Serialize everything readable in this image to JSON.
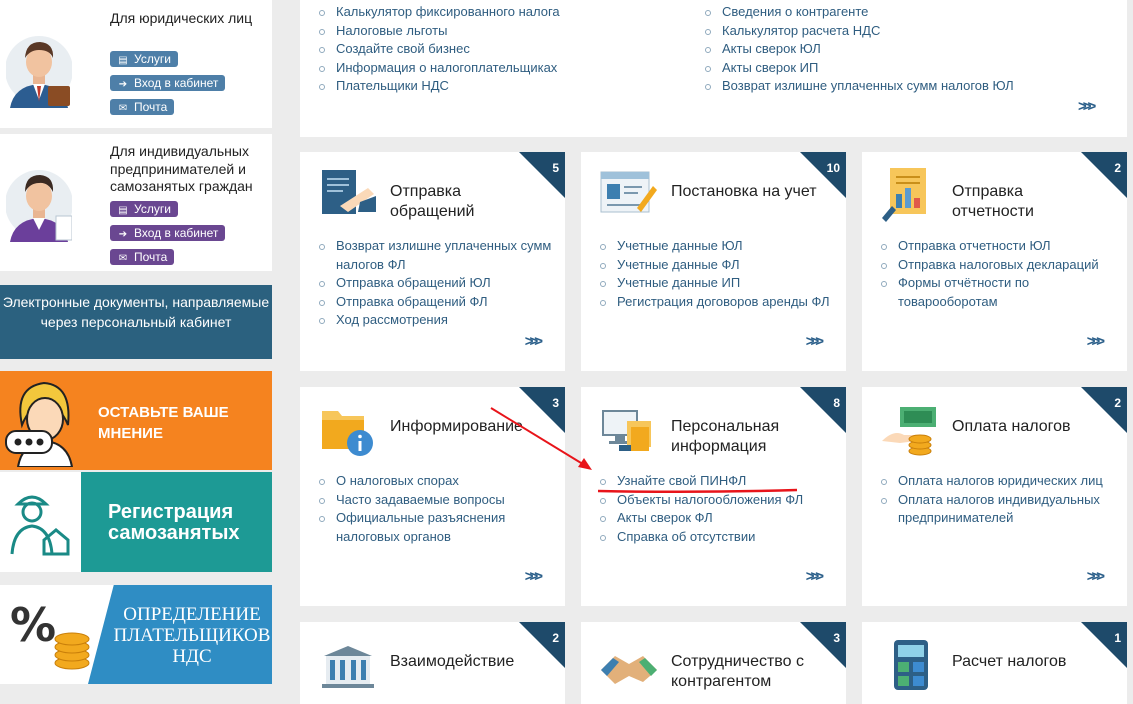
{
  "sidebar": {
    "legal": {
      "title": "Для юридических лиц",
      "buttons": [
        "Услуги",
        "Вход в кабинет",
        "Почта"
      ]
    },
    "individual": {
      "title": "Для индивидуальных предпринимателей и самозанятых граждан",
      "buttons": [
        "Услуги",
        "Вход в кабинет",
        "Почта"
      ]
    },
    "edocs": "Электронные документы, направляемые через персональный кабинет",
    "feedback_banner": "ОСТАВЬТЕ ВАШЕ МНЕНИЕ",
    "selfemployed_banner": "Регистрация самозанятых",
    "vat_banner": "ОПРЕДЕЛЕНИЕ ПЛАТЕЛЬЩИКОВ НДС"
  },
  "top_links": {
    "left": [
      "Калькулятор фиксированного налога",
      "Налоговые льготы",
      "Создайте свой бизнес",
      "Информация о налогоплательщиках",
      "Плательщики НДС"
    ],
    "right": [
      "Сведения о контрагенте",
      "Калькулятор расчета НДС",
      "Акты сверок ЮЛ",
      "Акты сверок ИП",
      "Возврат излишне уплаченных сумм налогов ЮЛ"
    ],
    "more": ">>>"
  },
  "cards": [
    {
      "title": "Отправка обращений",
      "count": "5",
      "icon": "document-signing-icon",
      "links": [
        "Возврат излишне уплаченных сумм налогов ФЛ",
        "Отправка обращений ЮЛ",
        "Отправка обращений ФЛ",
        "Ход рассмотрения"
      ]
    },
    {
      "title": "Постановка на учет",
      "count": "10",
      "icon": "id-card-icon",
      "links": [
        "Учетные данные ЮЛ",
        "Учетные данные ФЛ",
        "Учетные данные ИП",
        "Регистрация договоров аренды ФЛ"
      ]
    },
    {
      "title": "Отправка отчетности",
      "count": "2",
      "icon": "report-chart-icon",
      "links": [
        "Отправка отчетности ЮЛ",
        "Отправка налоговых деклараций",
        "Формы отчётности по товарооборотам"
      ]
    },
    {
      "title": "Информирование",
      "count": "3",
      "icon": "folder-info-icon",
      "links": [
        "О налоговых спорах",
        "Часто задаваемые вопросы",
        "Официальные разъяснения налоговых органов"
      ]
    },
    {
      "title": "Персональная информация",
      "count": "8",
      "icon": "computer-files-icon",
      "links": [
        "Узнайте свой ПИНФЛ",
        "Объекты налогообложения ФЛ",
        "Акты сверок ФЛ",
        "Справка об отсутствии"
      ]
    },
    {
      "title": "Оплата налогов",
      "count": "2",
      "icon": "money-coins-icon",
      "links": [
        "Оплата налогов юридических лиц",
        "Оплата налогов индивидуальных предпринимателей"
      ]
    },
    {
      "title": "Взаимодействие",
      "count": "2",
      "icon": "government-building-icon",
      "links": []
    },
    {
      "title": "Сотрудничество с контрагентом",
      "count": "3",
      "icon": "handshake-icon",
      "links": []
    },
    {
      "title": "Расчет налогов",
      "count": "1",
      "icon": "calculator-icon",
      "links": []
    }
  ],
  "colors": {
    "link": "#2f5d80",
    "corner": "#1e4a6a",
    "annotation": "#e8141a",
    "banner_orange": "#f5831f",
    "banner_teal": "#1d9a95"
  }
}
